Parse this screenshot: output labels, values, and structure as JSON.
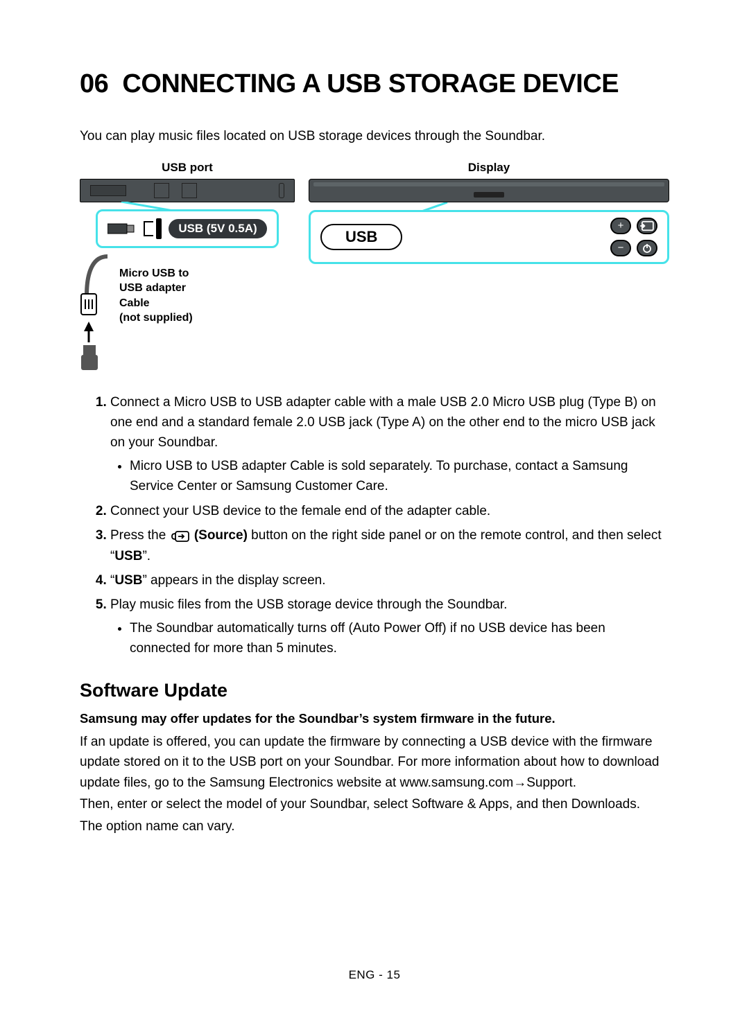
{
  "section_number": "06",
  "section_title": "CONNECTING A USB STORAGE DEVICE",
  "intro": "You can play music files located on USB storage devices through the Soundbar.",
  "diagram": {
    "left_label": "USB port",
    "right_label": "Display",
    "usb_port_pill": "USB (5V 0.5A)",
    "cable_note_l1": "Micro USB to",
    "cable_note_l2": "USB adapter Cable",
    "cable_note_l3": "(not supplied)",
    "display_text": "USB"
  },
  "steps": {
    "s1": "Connect a Micro USB to USB adapter cable with a male USB 2.0 Micro USB plug (Type B) on one end and a standard female 2.0 USB jack (Type A) on the other end to the micro USB jack on your Soundbar.",
    "s1_sub": "Micro USB to USB adapter Cable is sold separately. To purchase, contact a Samsung Service Center or Samsung Customer Care.",
    "s2": "Connect your USB device to the female end of the adapter cable.",
    "s3_a": "Press the ",
    "s3_source": " (Source)",
    "s3_b": " button on the right side panel or on the remote control, and then select “",
    "s3_usb": "USB",
    "s3_c": "”.",
    "s4_a": "“",
    "s4_usb": "USB",
    "s4_b": "” appears in the display screen.",
    "s5": "Play music files from the USB storage device through the Soundbar.",
    "s5_sub": "The Soundbar automatically turns off (Auto Power Off) if no USB device has been connected for more than 5 minutes."
  },
  "software": {
    "heading": "Software Update",
    "bold": "Samsung may offer updates for the Soundbar’s system firmware in the future.",
    "p1": "If an update is offered, you can update the firmware by connecting a USB device with the firmware update stored on it to the USB port on your Soundbar. For more information about how to download update files, go to the Samsung Electronics website at www.samsung.com→Support.",
    "p2": "Then, enter or select the model of your Soundbar, select Software & Apps, and then Downloads.",
    "p3": "The option name can vary."
  },
  "footer": "ENG - 15"
}
